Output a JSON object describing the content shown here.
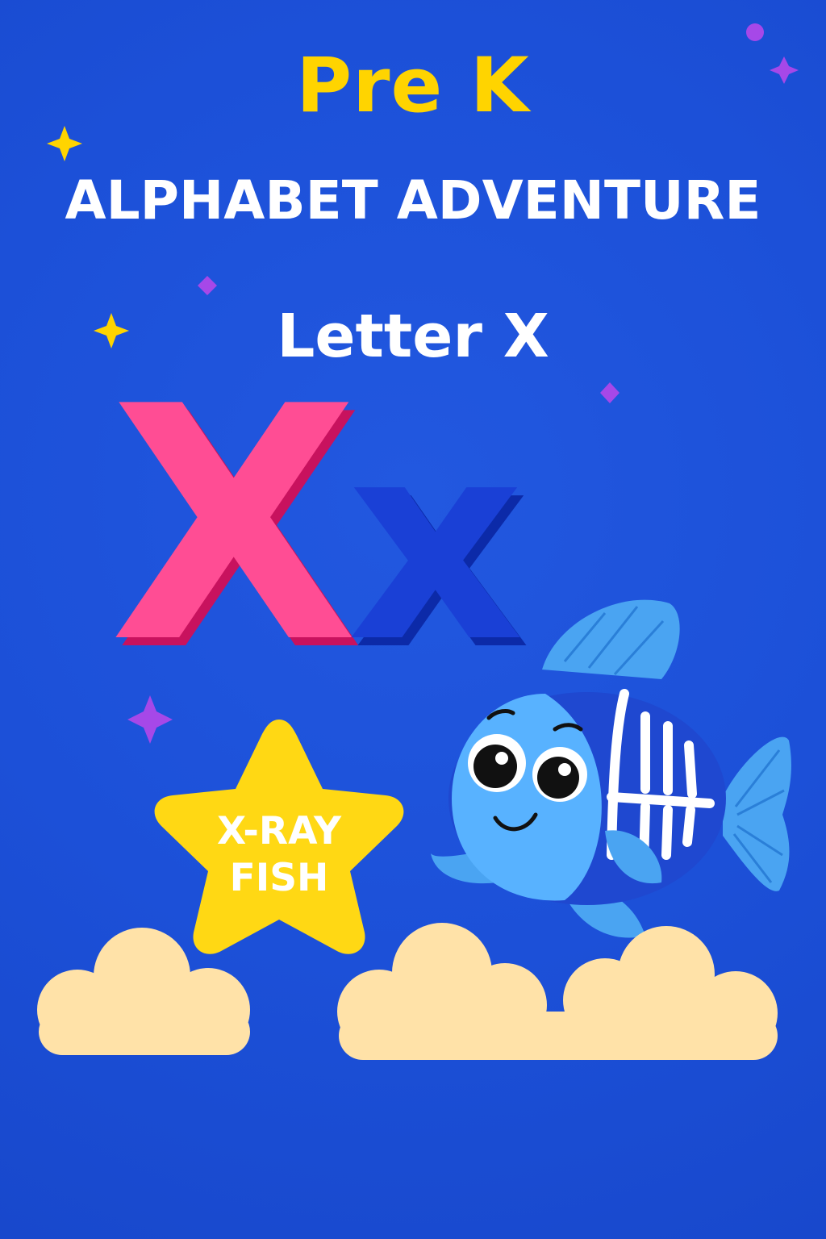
{
  "header": {
    "pre": "Pre K",
    "main": "ALPHABET ADVENTURE",
    "letter": "Letter X"
  },
  "letters": {
    "upper": "X",
    "lower": "x"
  },
  "star": {
    "line1": "X-RAY",
    "line2": "FISH"
  },
  "colors": {
    "background": "#1c50d8",
    "title_yellow": "#ffd400",
    "upper_letter": "#ff4d94",
    "lower_letter": "#1a40d6",
    "star": "#ffd814",
    "fish_light": "#58b2ff",
    "fish_dark": "#1f48d0",
    "cloud": "#ffe2a8"
  },
  "icons": [
    "sparkle-icon",
    "star-icon",
    "xray-fish-icon",
    "cloud-icon"
  ]
}
